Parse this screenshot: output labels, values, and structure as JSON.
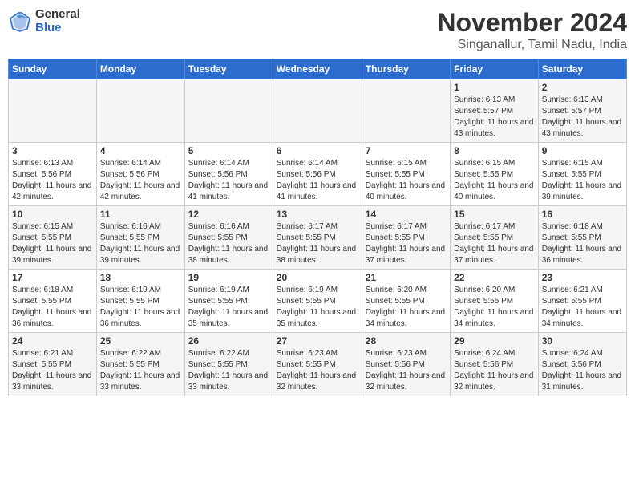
{
  "logo": {
    "general": "General",
    "blue": "Blue"
  },
  "title": "November 2024",
  "location": "Singanallur, Tamil Nadu, India",
  "days_of_week": [
    "Sunday",
    "Monday",
    "Tuesday",
    "Wednesday",
    "Thursday",
    "Friday",
    "Saturday"
  ],
  "weeks": [
    [
      {
        "day": "",
        "info": ""
      },
      {
        "day": "",
        "info": ""
      },
      {
        "day": "",
        "info": ""
      },
      {
        "day": "",
        "info": ""
      },
      {
        "day": "",
        "info": ""
      },
      {
        "day": "1",
        "info": "Sunrise: 6:13 AM\nSunset: 5:57 PM\nDaylight: 11 hours and 43 minutes."
      },
      {
        "day": "2",
        "info": "Sunrise: 6:13 AM\nSunset: 5:57 PM\nDaylight: 11 hours and 43 minutes."
      }
    ],
    [
      {
        "day": "3",
        "info": "Sunrise: 6:13 AM\nSunset: 5:56 PM\nDaylight: 11 hours and 42 minutes."
      },
      {
        "day": "4",
        "info": "Sunrise: 6:14 AM\nSunset: 5:56 PM\nDaylight: 11 hours and 42 minutes."
      },
      {
        "day": "5",
        "info": "Sunrise: 6:14 AM\nSunset: 5:56 PM\nDaylight: 11 hours and 41 minutes."
      },
      {
        "day": "6",
        "info": "Sunrise: 6:14 AM\nSunset: 5:56 PM\nDaylight: 11 hours and 41 minutes."
      },
      {
        "day": "7",
        "info": "Sunrise: 6:15 AM\nSunset: 5:55 PM\nDaylight: 11 hours and 40 minutes."
      },
      {
        "day": "8",
        "info": "Sunrise: 6:15 AM\nSunset: 5:55 PM\nDaylight: 11 hours and 40 minutes."
      },
      {
        "day": "9",
        "info": "Sunrise: 6:15 AM\nSunset: 5:55 PM\nDaylight: 11 hours and 39 minutes."
      }
    ],
    [
      {
        "day": "10",
        "info": "Sunrise: 6:15 AM\nSunset: 5:55 PM\nDaylight: 11 hours and 39 minutes."
      },
      {
        "day": "11",
        "info": "Sunrise: 6:16 AM\nSunset: 5:55 PM\nDaylight: 11 hours and 39 minutes."
      },
      {
        "day": "12",
        "info": "Sunrise: 6:16 AM\nSunset: 5:55 PM\nDaylight: 11 hours and 38 minutes."
      },
      {
        "day": "13",
        "info": "Sunrise: 6:17 AM\nSunset: 5:55 PM\nDaylight: 11 hours and 38 minutes."
      },
      {
        "day": "14",
        "info": "Sunrise: 6:17 AM\nSunset: 5:55 PM\nDaylight: 11 hours and 37 minutes."
      },
      {
        "day": "15",
        "info": "Sunrise: 6:17 AM\nSunset: 5:55 PM\nDaylight: 11 hours and 37 minutes."
      },
      {
        "day": "16",
        "info": "Sunrise: 6:18 AM\nSunset: 5:55 PM\nDaylight: 11 hours and 36 minutes."
      }
    ],
    [
      {
        "day": "17",
        "info": "Sunrise: 6:18 AM\nSunset: 5:55 PM\nDaylight: 11 hours and 36 minutes."
      },
      {
        "day": "18",
        "info": "Sunrise: 6:19 AM\nSunset: 5:55 PM\nDaylight: 11 hours and 36 minutes."
      },
      {
        "day": "19",
        "info": "Sunrise: 6:19 AM\nSunset: 5:55 PM\nDaylight: 11 hours and 35 minutes."
      },
      {
        "day": "20",
        "info": "Sunrise: 6:19 AM\nSunset: 5:55 PM\nDaylight: 11 hours and 35 minutes."
      },
      {
        "day": "21",
        "info": "Sunrise: 6:20 AM\nSunset: 5:55 PM\nDaylight: 11 hours and 34 minutes."
      },
      {
        "day": "22",
        "info": "Sunrise: 6:20 AM\nSunset: 5:55 PM\nDaylight: 11 hours and 34 minutes."
      },
      {
        "day": "23",
        "info": "Sunrise: 6:21 AM\nSunset: 5:55 PM\nDaylight: 11 hours and 34 minutes."
      }
    ],
    [
      {
        "day": "24",
        "info": "Sunrise: 6:21 AM\nSunset: 5:55 PM\nDaylight: 11 hours and 33 minutes."
      },
      {
        "day": "25",
        "info": "Sunrise: 6:22 AM\nSunset: 5:55 PM\nDaylight: 11 hours and 33 minutes."
      },
      {
        "day": "26",
        "info": "Sunrise: 6:22 AM\nSunset: 5:55 PM\nDaylight: 11 hours and 33 minutes."
      },
      {
        "day": "27",
        "info": "Sunrise: 6:23 AM\nSunset: 5:55 PM\nDaylight: 11 hours and 32 minutes."
      },
      {
        "day": "28",
        "info": "Sunrise: 6:23 AM\nSunset: 5:56 PM\nDaylight: 11 hours and 32 minutes."
      },
      {
        "day": "29",
        "info": "Sunrise: 6:24 AM\nSunset: 5:56 PM\nDaylight: 11 hours and 32 minutes."
      },
      {
        "day": "30",
        "info": "Sunrise: 6:24 AM\nSunset: 5:56 PM\nDaylight: 11 hours and 31 minutes."
      }
    ]
  ]
}
